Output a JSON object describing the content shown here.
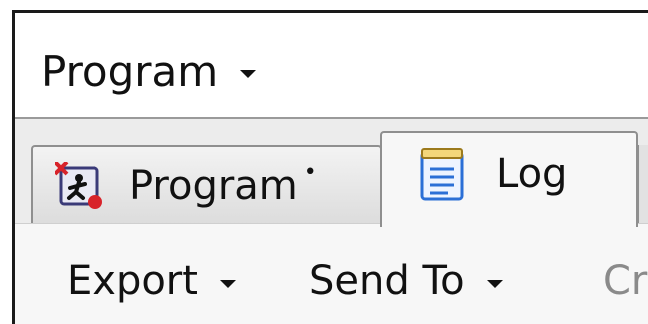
{
  "header": {
    "program_menu_label": "Program"
  },
  "tabs": [
    {
      "label": "Program",
      "modified_marker": "•",
      "icon": "program-run-icon"
    },
    {
      "label": "Log",
      "icon": "notepad-icon",
      "active": true
    }
  ],
  "toolbar": {
    "export_label": "Export",
    "send_to_label": "Send To",
    "truncated_label": "Cr"
  },
  "colors": {
    "error_red": "#d8232a",
    "log_icon_blue": "#2b6fd6"
  }
}
